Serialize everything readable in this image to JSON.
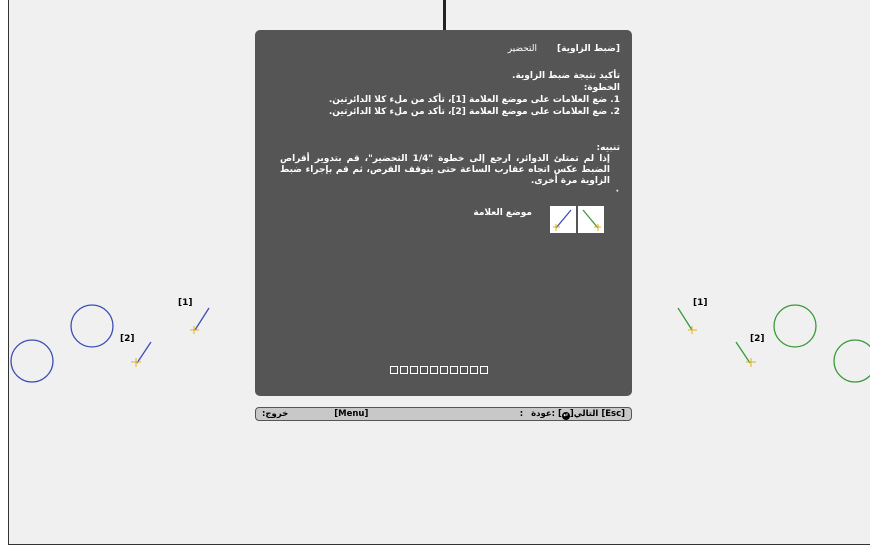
{
  "panel": {
    "tab_active": "[ضبط الزاوية]",
    "tab_next": "التحضير",
    "intro": "تأكيد نتيجة ضبط الزاوية.",
    "steps_heading": "الخطوة:",
    "step1": "1. ضع العلامات على موضع العلامة [1]، تأكد من ملء كلا الدائرتين.",
    "step2": "2. ضع العلامات على موضع العلامة [2]، تأكد من ملء كلا الدائرتين.",
    "caution_heading": "تنبيه:",
    "caution_bullet": "·",
    "caution_text": "إذا لم تمتلئ الدوائر، ارجع إلى خطوة \"1/4 التحضير\"، قم بتدوير أقراص الضبط عكس اتجاه عقارب الساعة حتى يتوقف القرص، ثم قم بإجراء ضبط الزاوية مرة أخرى.",
    "mark_position_label": "موضع العلامة",
    "progress_total": 10
  },
  "footer": {
    "esc": "[Esc]",
    "back": ":عودة",
    "enter_key": "[",
    "enter_key_end": "]",
    "next": ":التالي",
    "menu": "[Menu]",
    "exit": ":خروج"
  },
  "markers": {
    "left_1": "[1]",
    "left_2": "[2]",
    "right_1": "[1]",
    "right_2": "[2]"
  },
  "colors": {
    "panel_bg": "#555555",
    "left_circle": "#3b4fb5",
    "right_circle": "#3a9a3a",
    "mark_yellow": "#e0b020"
  }
}
